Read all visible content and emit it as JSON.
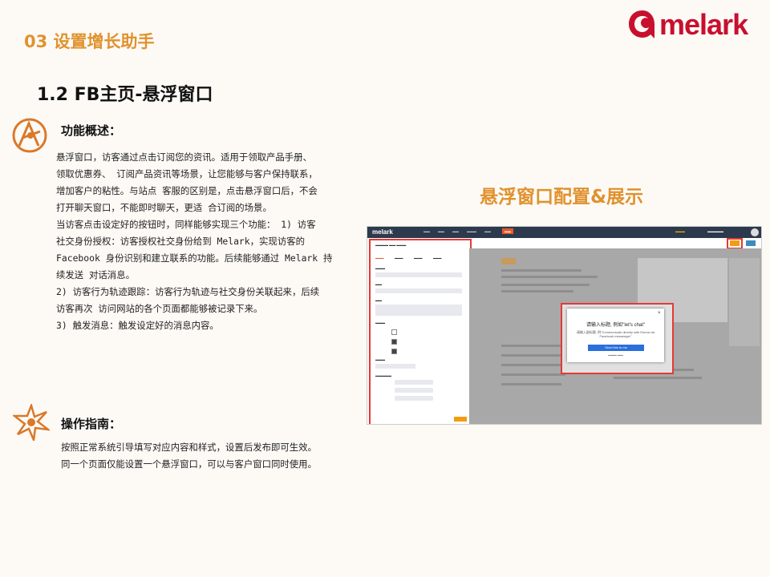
{
  "brand": {
    "logo_text": "melark",
    "accent": "#c8102e"
  },
  "header": {
    "section_title": "03 设置增长助手",
    "subtitle": "1.2 FB主页-悬浮窗口"
  },
  "overview": {
    "heading": "功能概述：",
    "icon": "atom-icon",
    "lines": [
      "悬浮窗口，访客通过点击订阅您的资讯。适用于领取产品手册、",
      "领取优惠券、 订阅产品资讯等场景，让您能够与客户保持联系，",
      "增加客户的粘性。与站点 客服的区别是，点击悬浮窗口后，不会",
      "打开聊天窗口，不能即时聊天，更适 合订阅的场景。",
      "当访客点击设定好的按钮时，同样能够实现三个功能： 1) 访客",
      "社交身份授权：访客授权社交身份给到 Melark，实现访客的",
      "Facebook 身份识别和建立联系的功能。后续能够通过 Melark 持",
      "续发送 对话消息。",
      "2) 访客行为轨迹跟踪：访客行为轨迹与社交身份关联起来，后续",
      "访客再次 访问网站的各个页面都能够被记录下来。",
      "3) 触发消息：触发设定好的消息内容。"
    ]
  },
  "guide": {
    "heading": "操作指南：",
    "icon": "star-burst-icon",
    "lines": [
      "按照正常系统引导填写对应内容和样式，设置后发布即可生效。",
      "同一个页面仅能设置一个悬浮窗口，可以与客户窗口同时使用。"
    ]
  },
  "screenshot": {
    "caption": "悬浮窗口配置&展示",
    "app_logo": "melark",
    "popup_title": "请输入标题, 例如\"let's chat\"",
    "popup_subtitle": "请输入副标题, 例\"Communicate directly with Emma via Facebook messenger\"",
    "popup_button": "Send this to me",
    "popup_close": "×"
  }
}
